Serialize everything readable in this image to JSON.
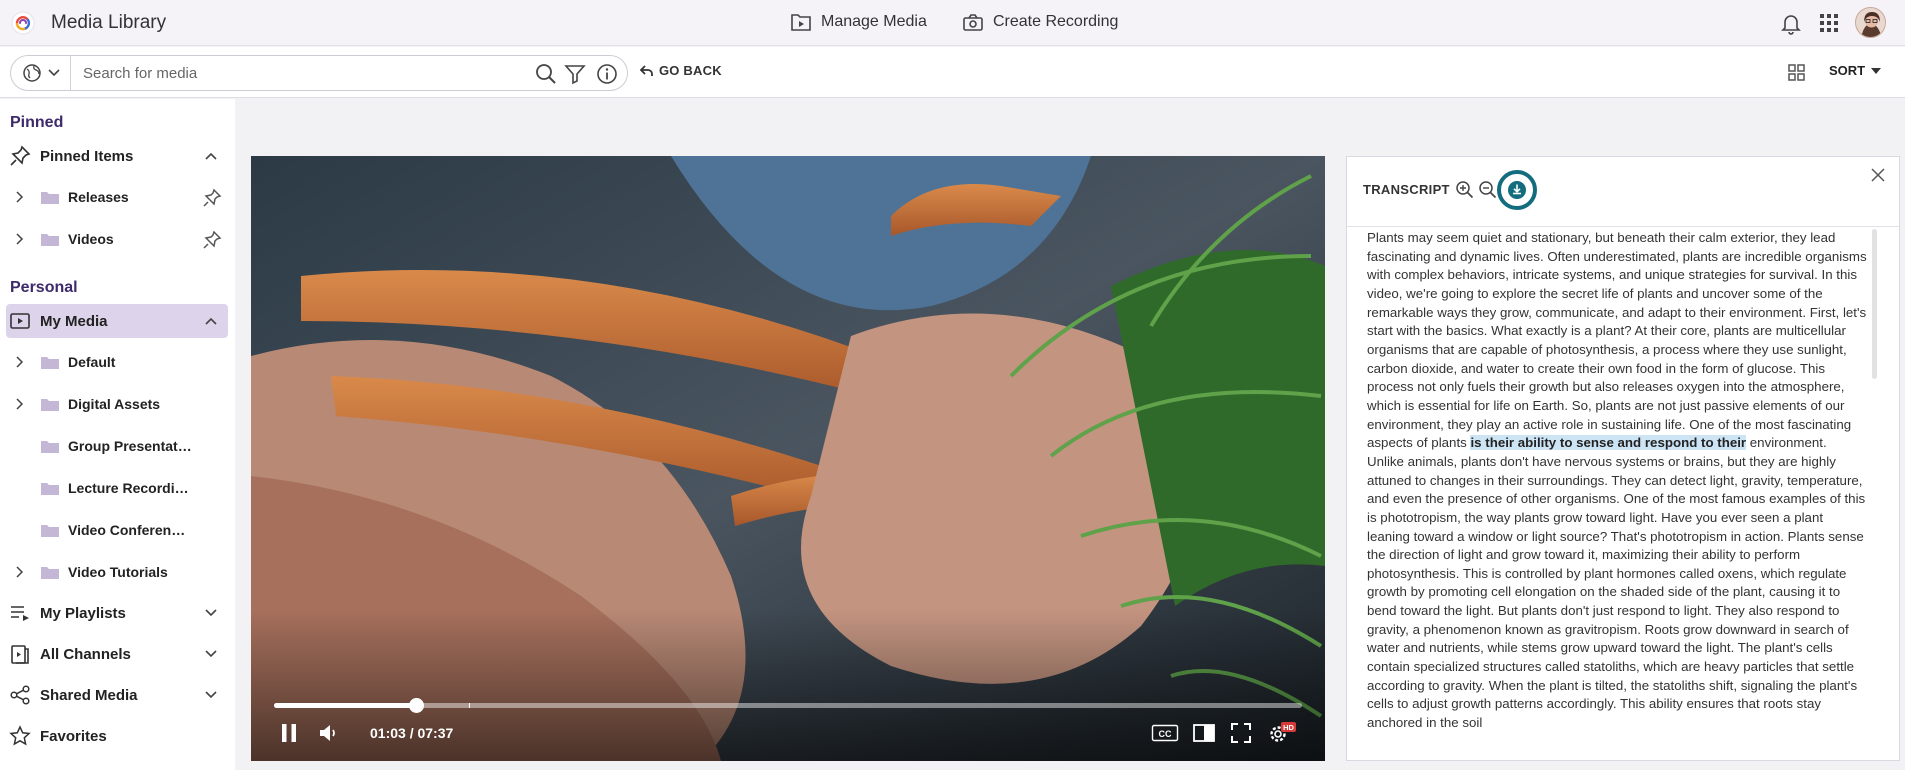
{
  "header": {
    "app_title": "Media Library",
    "nav": [
      {
        "label": "Manage Media",
        "icon": "manage-media-icon"
      },
      {
        "label": "Create Recording",
        "icon": "record-icon"
      }
    ],
    "icons": [
      "notification-bell-icon",
      "apps-grid-icon",
      "user-avatar"
    ]
  },
  "search": {
    "placeholder": "Search for media",
    "value": "",
    "go_back_label": "GO BACK",
    "sort_label": "SORT"
  },
  "sidebar": {
    "pinned_heading": "Pinned",
    "pinned_items_label": "Pinned Items",
    "pinned_folders": [
      {
        "label": "Releases",
        "expandable": true
      },
      {
        "label": "Videos",
        "expandable": true
      }
    ],
    "personal_heading": "Personal",
    "my_media_label": "My Media",
    "my_media_folders": [
      {
        "label": "Default",
        "expandable": true
      },
      {
        "label": "Digital Assets",
        "expandable": true
      },
      {
        "label": "Group Presentat…",
        "expandable": false
      },
      {
        "label": "Lecture Recordi…",
        "expandable": false
      },
      {
        "label": "Video Conferen…",
        "expandable": false
      },
      {
        "label": "Video Tutorials",
        "expandable": true
      }
    ],
    "sections": [
      {
        "label": "My Playlists",
        "icon": "playlist-icon"
      },
      {
        "label": "All Channels",
        "icon": "channels-icon"
      },
      {
        "label": "Shared Media",
        "icon": "share-icon"
      },
      {
        "label": "Favorites",
        "icon": "star-icon"
      }
    ]
  },
  "player": {
    "current_time": "01:03",
    "duration": "07:37",
    "time_display": "01:03 / 07:37",
    "progress_fraction": 0.138,
    "buffered_fraction": 0.19,
    "cc_label": "CC",
    "quality_badge": "HD"
  },
  "transcript": {
    "title": "TRANSCRIPT",
    "text_before": "Plants may seem quiet and stationary, but beneath their calm exterior, they lead fascinating and dynamic lives. Often underestimated, plants are incredible organisms with complex behaviors, intricate systems, and unique strategies for survival. In this video, we're going to explore the secret life of plants and uncover some of the remarkable ways they grow, communicate, and adapt to their environment. First, let's start with the basics. What exactly is a plant? At their core, plants are multicellular organisms that are capable of photosynthesis, a process where they use sunlight, carbon dioxide, and water to create their own food in the form of glucose. This process not only fuels their growth but also releases oxygen into the atmosphere, which is essential for life on Earth. So, plants are not just passive elements of our environment, they play an active role in sustaining life. One of the most fascinating aspects of plants ",
    "text_highlight": "is their ability to sense and respond to their",
    "text_after": " environment. Unlike animals, plants don't have nervous systems or brains, but they are highly attuned to changes in their surroundings. They can detect light, gravity, temperature, and even the presence of other organisms. One of the most famous examples of this is phototropism, the way plants grow toward light. Have you ever seen a plant leaning toward a window or light source? That's phototropism in action. Plants sense the direction of light and grow toward it, maximizing their ability to perform photosynthesis. This is controlled by plant hormones called oxens, which regulate growth by promoting cell elongation on the shaded side of the plant, causing it to bend toward the light. But plants don't just respond to light. They also respond to gravity, a phenomenon known as gravitropism. Roots grow downward in search of water and nutrients, while stems grow upward toward the light. The plant's cells contain specialized structures called statoliths, which are heavy particles that settle according to gravity. When the plant is tilted, the statoliths shift, signaling the plant's cells to adjust growth patterns accordingly. This ability ensures that roots stay anchored in the soil"
  },
  "colors": {
    "accent": "#3e2a6b",
    "active_row": "#ddd3ea",
    "download_ring": "#146d7e",
    "highlight": "#cde4f5"
  }
}
